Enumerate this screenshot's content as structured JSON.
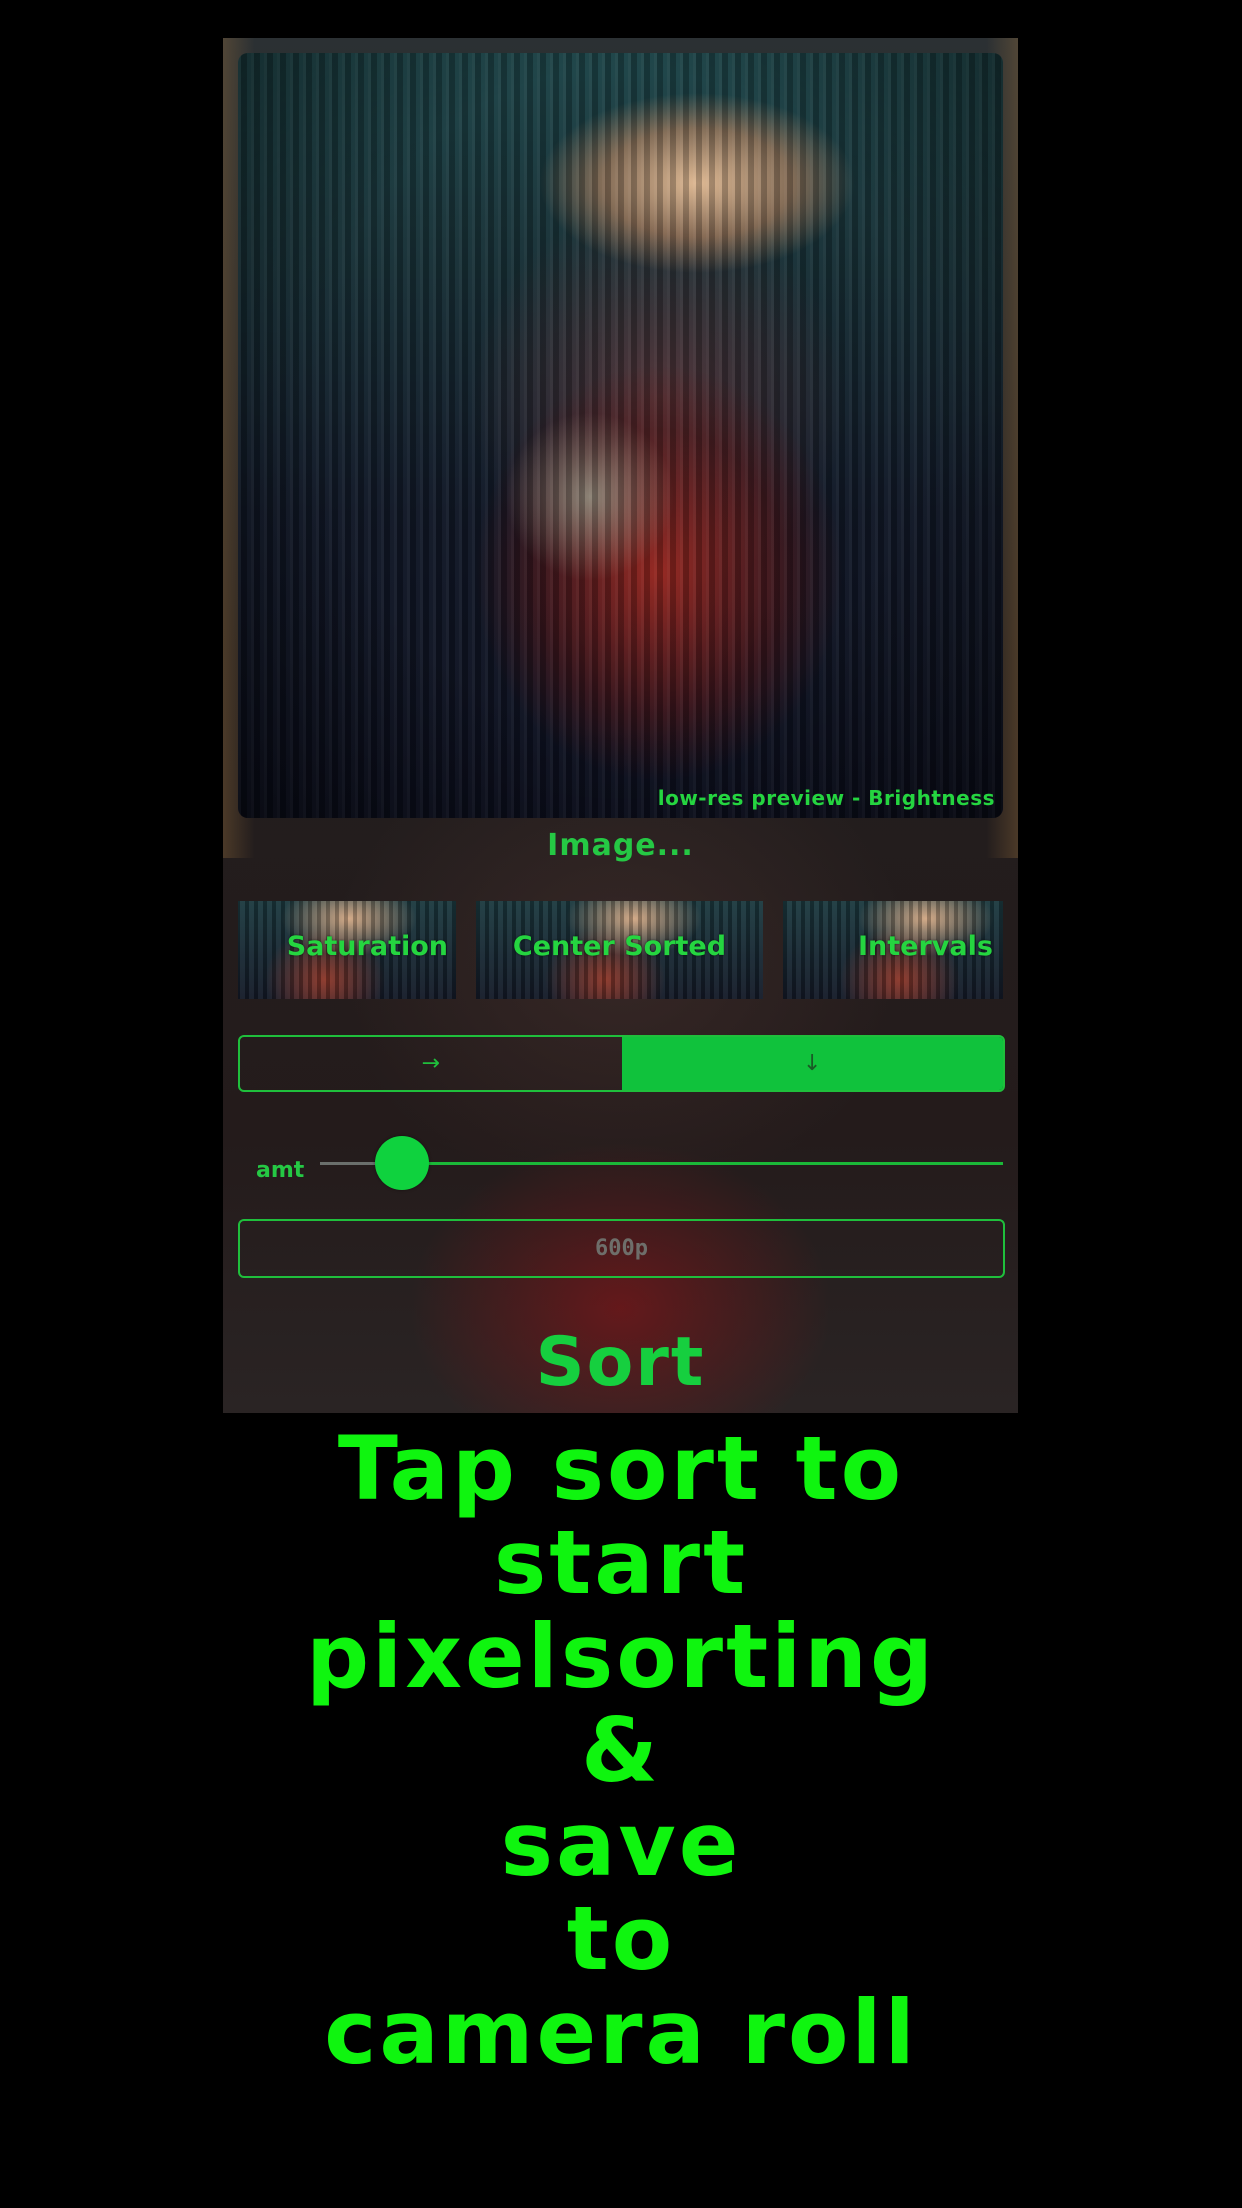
{
  "preview": {
    "caption": "low-res preview - Brightness"
  },
  "image_button": "Image...",
  "effects": [
    {
      "label": "Saturation"
    },
    {
      "label": "Center Sorted"
    },
    {
      "label": "Intervals"
    }
  ],
  "direction": {
    "horizontal_icon": "→",
    "vertical_icon": "↓",
    "selected": "vertical"
  },
  "amount": {
    "label": "amt",
    "value": 0.12
  },
  "resolution": {
    "value": "600p"
  },
  "sort_button": "Sort",
  "promo": {
    "line1": "Tap sort to",
    "line2": "start",
    "line3": "pixelsorting",
    "line4": "&",
    "line5": "save",
    "line6": "to",
    "line7": "camera roll"
  },
  "colors": {
    "accent": "#10c23c",
    "promo": "#0ff50f",
    "background": "#000000"
  }
}
